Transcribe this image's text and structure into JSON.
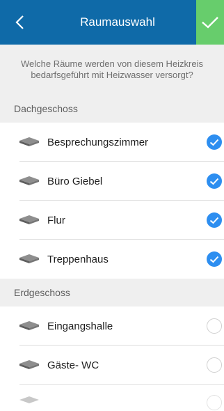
{
  "header": {
    "back_symbol": "<",
    "title": "Raumauswahl",
    "colors": {
      "bar": "#0f6aa8",
      "confirm": "#67cd6c"
    }
  },
  "description": "Welche Räume werden von diesem Heizkreis bedarfsgeführt mit Heizwasser versorgt?",
  "sections": [
    {
      "title": "Dachgeschoss",
      "rooms": [
        {
          "label": "Besprechungszimmer",
          "selected": true
        },
        {
          "label": "Büro Giebel",
          "selected": true
        },
        {
          "label": "Flur",
          "selected": true
        },
        {
          "label": "Treppenhaus",
          "selected": true
        }
      ]
    },
    {
      "title": "Erdgeschoss",
      "rooms": [
        {
          "label": "Eingangshalle",
          "selected": false
        },
        {
          "label": "Gäste- WC",
          "selected": false
        }
      ]
    }
  ],
  "icons": {
    "back": "chevron-left-icon",
    "confirm": "checkmark-icon",
    "room": "room-floor-icon",
    "selected": "check-circle-icon",
    "unselected": "empty-circle-icon"
  },
  "colors": {
    "selected": "#2d8ef0",
    "unselected_border": "#cfcfcf"
  }
}
